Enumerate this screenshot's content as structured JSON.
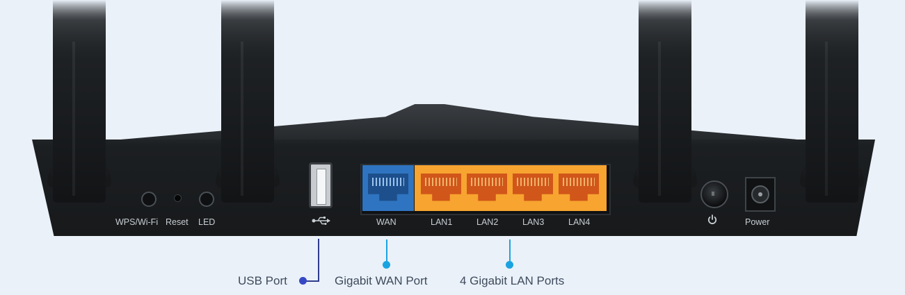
{
  "router": {
    "labels": {
      "wps": "WPS/Wi-Fi",
      "reset": "Reset",
      "led": "LED",
      "usb_symbol": "⭠",
      "wan": "WAN",
      "lan1": "LAN1",
      "lan2": "LAN2",
      "lan3": "LAN3",
      "lan4": "LAN4",
      "power_symbol": "⏻",
      "power": "Power"
    }
  },
  "callouts": {
    "usb": "USB Port",
    "wan": "Gigabit WAN Port",
    "lan": "4 Gigabit LAN Ports"
  },
  "colors": {
    "wan_port": "#2f74c0",
    "lan_ports": "#f7a430",
    "callout_usb": "#3748c4",
    "callout_ports": "#1aa3e0"
  },
  "icons": [
    "wps-button-icon",
    "reset-pinhole-icon",
    "led-button-icon",
    "usb-icon",
    "power-icon",
    "dc-power-jack-icon"
  ]
}
